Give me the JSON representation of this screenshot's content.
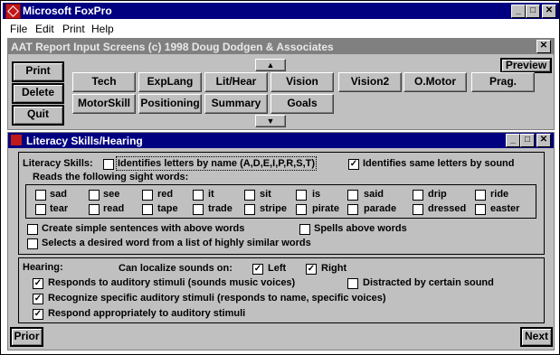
{
  "app": {
    "title": "Microsoft FoxPro",
    "menu": [
      "File",
      "Edit",
      "Print",
      "Help"
    ]
  },
  "panel_top": {
    "title": "AAT Report Input Screens (c) 1998 Doug Dodgen & Associates",
    "left_buttons": [
      "Print",
      "Delete",
      "Quit"
    ],
    "preview": "Preview",
    "row1": [
      "Tech",
      "ExpLang",
      "Lit/Hear",
      "Vision",
      "Vision2",
      "O.Motor",
      "Prag."
    ],
    "row2": [
      "MotorSkill",
      "Positioning",
      "Summary",
      "Goals"
    ]
  },
  "panel_main": {
    "title": "Literacy Skills/Hearing",
    "literacy": {
      "label": "Literacy Skills:",
      "identify_name": {
        "label": "Identifies letters by name (A,D,E,I,P,R,S,T)",
        "checked": false
      },
      "identify_same": {
        "label": "Identifies same letters by sound",
        "checked": true
      },
      "sight_label": "Reads the following sight words:",
      "words_row1": [
        "sad",
        "see",
        "red",
        "it",
        "sit",
        "is",
        "said",
        "drip",
        "ride"
      ],
      "words_row2": [
        "tear",
        "read",
        "tape",
        "trade",
        "stripe",
        "pirate",
        "parade",
        "dressed",
        "easter"
      ],
      "simple_sentences": {
        "label": "Create simple sentences with above words",
        "checked": false
      },
      "spells": {
        "label": "Spells above words",
        "checked": false
      },
      "selects": {
        "label": "Selects a desired word from a list of highly similar words",
        "checked": false
      }
    },
    "hearing": {
      "label": "Hearing:",
      "localize_label": "Can localize sounds on:",
      "left": {
        "label": "Left",
        "checked": true
      },
      "right": {
        "label": "Right",
        "checked": true
      },
      "responds": {
        "label": "Responds to auditory stimuli (sounds music voices)",
        "checked": true
      },
      "distracted": {
        "label": "Distracted by certain sound",
        "checked": false
      },
      "recognize": {
        "label": "Recognize specific auditory stimuli (responds to name, specific voices)",
        "checked": true
      },
      "respond_appropriately": {
        "label": "Respond appropriately to auditory stimuli",
        "checked": true
      }
    },
    "nav": {
      "prior": "Prior",
      "next": "Next"
    }
  }
}
